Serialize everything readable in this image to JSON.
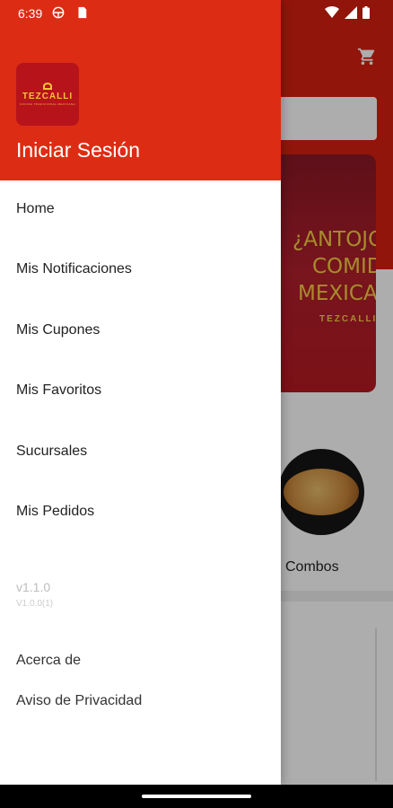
{
  "status_bar": {
    "time": "6:39",
    "left_icons": [
      "vpn-icon",
      "sd-card-icon"
    ],
    "right_icons": [
      "wifi-icon",
      "signal-icon",
      "battery-icon"
    ]
  },
  "background": {
    "banner_lines": [
      "¿ANTOJO",
      "COMIDA",
      "MEXICAN"
    ],
    "banner_logo": "TEZCALLI",
    "category_label": "Combos"
  },
  "drawer": {
    "logo_text": "TEZCALLI",
    "logo_subtext": "COCINA TRADICIONAL MEXICANA",
    "login_label": "Iniciar Sesión",
    "menu_items": [
      {
        "label": "Home"
      },
      {
        "label": "Mis Notificaciones"
      },
      {
        "label": "Mis Cupones"
      },
      {
        "label": "Mis Favoritos"
      },
      {
        "label": "Sucursales"
      },
      {
        "label": "Mis Pedidos"
      }
    ],
    "version": "v1.1.0",
    "build": "V1.0.0(1)",
    "footer_links": [
      {
        "label": "Acerca de"
      },
      {
        "label": "Aviso de Privacidad"
      }
    ]
  },
  "colors": {
    "header_red": "#dd2c14",
    "logo_red": "#b6131b",
    "logo_gold": "#f6c233"
  }
}
